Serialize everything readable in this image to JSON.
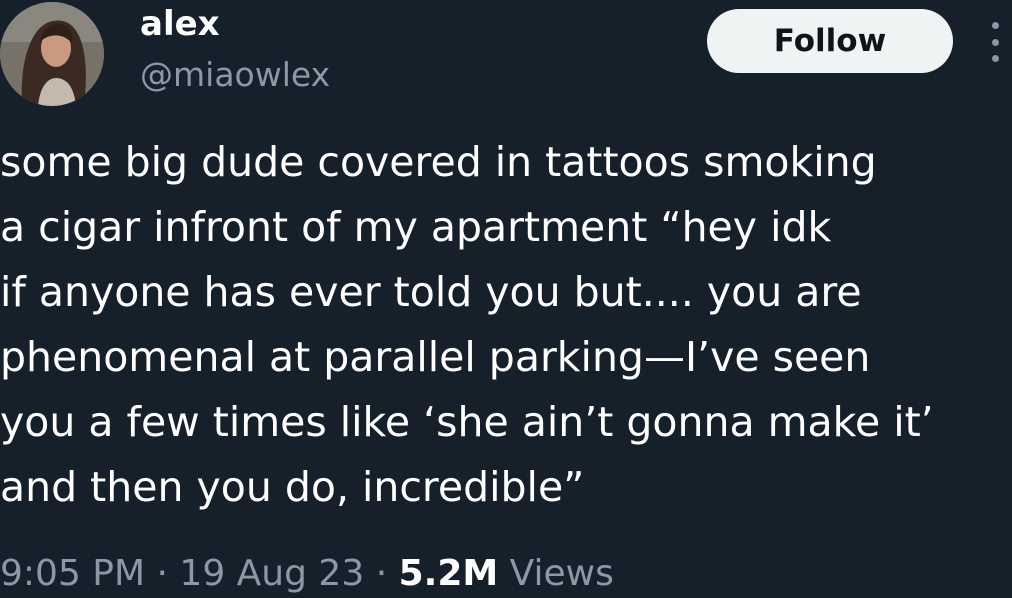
{
  "author": {
    "name": "alex",
    "handle": "@miaowlex"
  },
  "follow_label": "Follow",
  "more_icon": "ellipsis-vertical-icon",
  "tweet_lines": [
    "some big dude covered in tattoos smoking",
    "a cigar infront of my apartment “hey idk",
    "if anyone has ever told you but.... you are",
    "phenomenal at parallel parking—I’ve seen",
    "you a few times like ‘she ain’t gonna make it’",
    "and then you do, incredible”"
  ],
  "meta": {
    "time": "9:05 PM",
    "separator": "·",
    "date": "19 Aug 23",
    "views_count": "5.2M",
    "views_label": "Views"
  },
  "colors": {
    "background": "#15202b",
    "primary_text": "#ffffff",
    "secondary_text": "#8b98a5",
    "follow_bg": "#eff3f4",
    "follow_text": "#0f1419"
  }
}
